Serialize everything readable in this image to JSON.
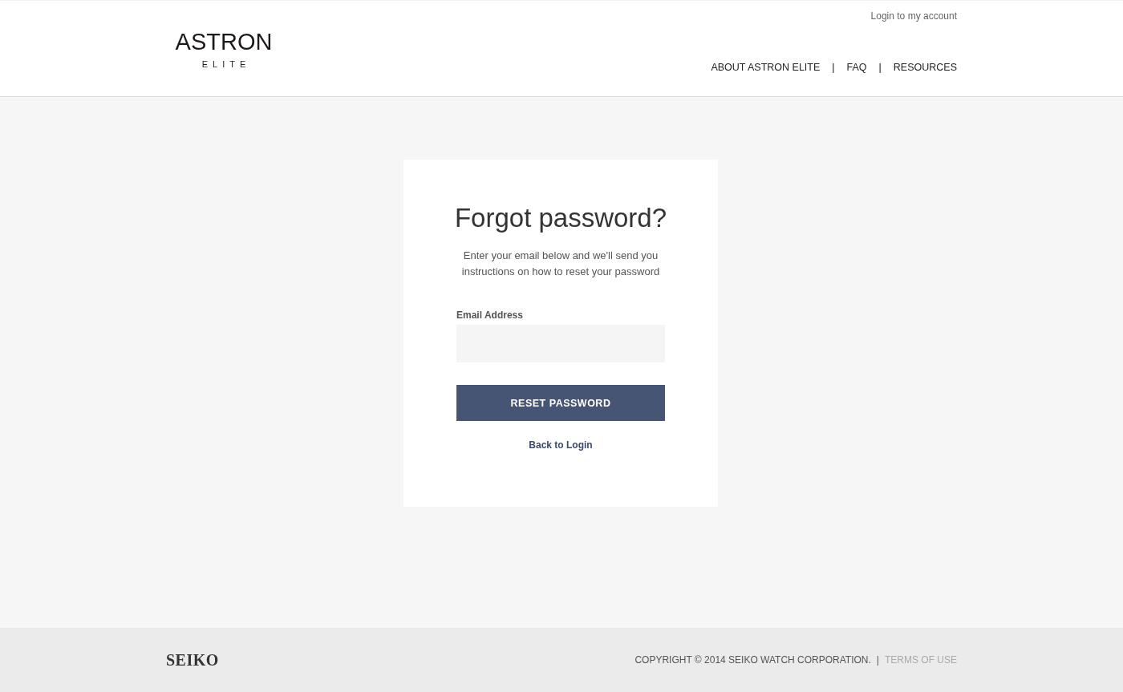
{
  "header": {
    "logo": {
      "main": "ASTRON",
      "sub": "ELITE"
    },
    "account_link": "Login to my account",
    "nav": [
      {
        "kind": "link",
        "text": "ABOUT ASTRON ELITE"
      },
      {
        "kind": "separator",
        "text": "|"
      },
      {
        "kind": "link",
        "text": "FAQ"
      },
      {
        "kind": "separator",
        "text": "|"
      },
      {
        "kind": "link",
        "text": "RESOURCES"
      }
    ]
  },
  "form": {
    "title": "Forgot password?",
    "description": "Enter your email below and we'll send you instructions on how to reset your password",
    "email": {
      "label": "Email Address"
    },
    "submit": "RESET PASSWORD",
    "back_link": "Back to Login"
  },
  "footer": {
    "logo": "SEIKO",
    "copyright": "COPYRIGHT © 2014 SEIKO WATCH CORPORATION.",
    "separator": "|",
    "terms_link": "TERMS OF USE"
  }
}
